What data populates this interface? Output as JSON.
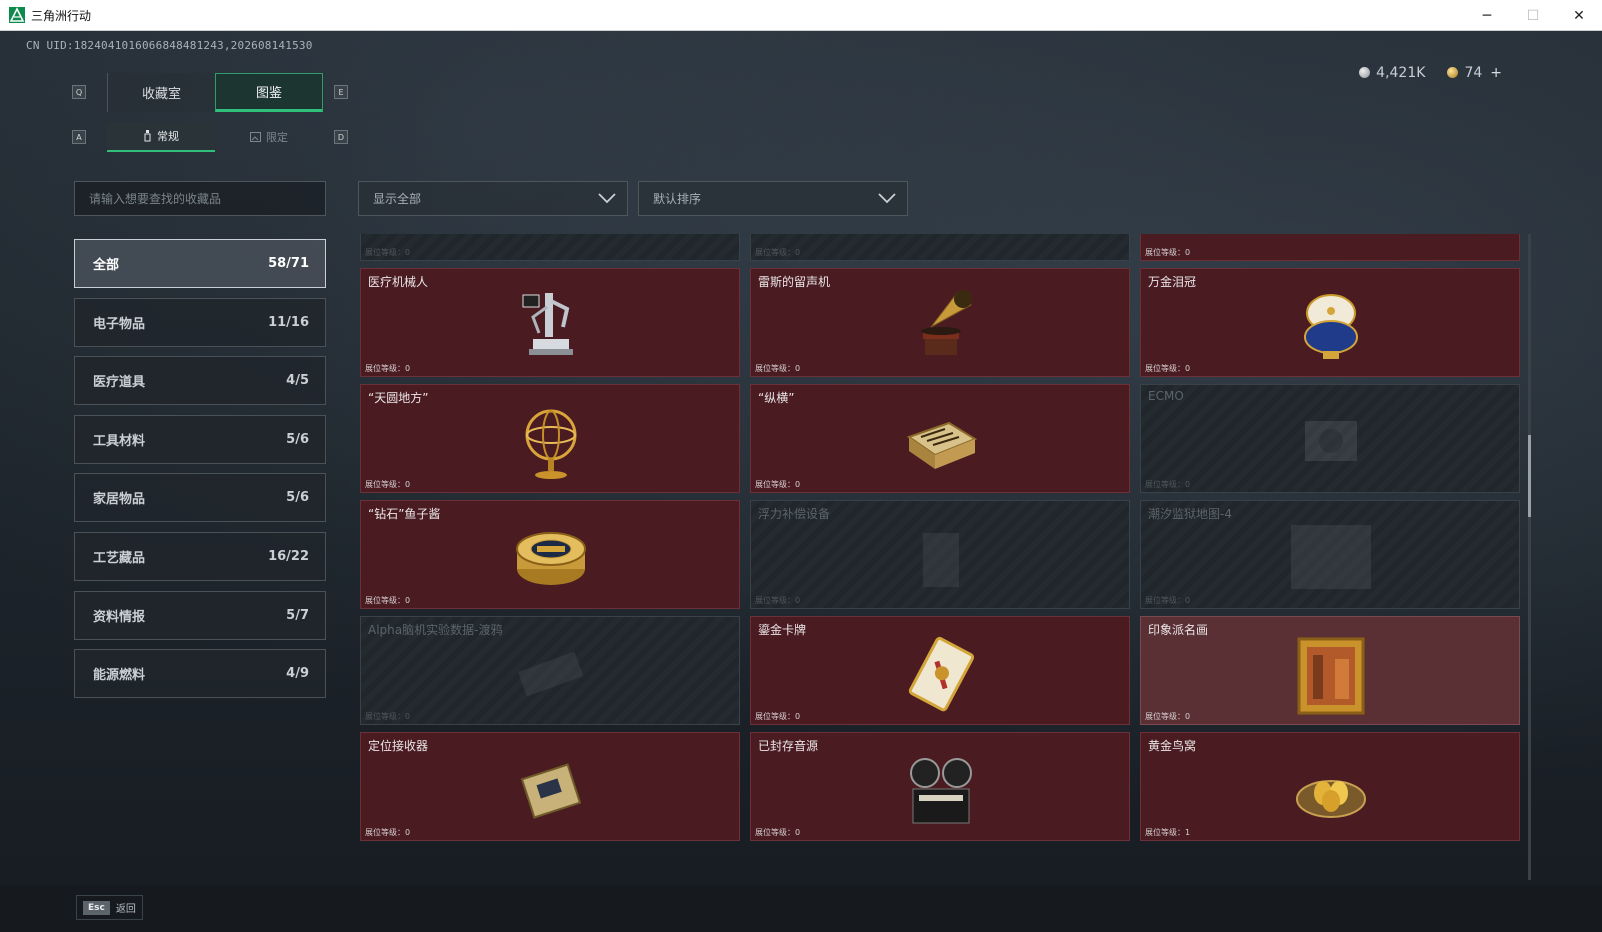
{
  "window": {
    "title": "三角洲行动",
    "minimize": "─",
    "maximize": "☐",
    "close": "✕"
  },
  "uid": "CN UID:1824041016066848481243,202608141530",
  "currency": {
    "silver": "4,421K",
    "gold": "74",
    "plus": "+"
  },
  "keys": {
    "q": "Q",
    "e": "E",
    "a": "A",
    "d": "D"
  },
  "tabs": [
    {
      "label": "收藏室"
    },
    {
      "label": "图鉴",
      "active": true
    }
  ],
  "subtabs": [
    {
      "label": "常规",
      "icon": "bottle-icon",
      "active": true
    },
    {
      "label": "限定",
      "icon": "picture-icon"
    }
  ],
  "search": {
    "placeholder": "请输入想要查找的收藏品"
  },
  "filters": {
    "show": "显示全部",
    "sort": "默认排序"
  },
  "categories": [
    {
      "label": "全部",
      "count": "58/71",
      "active": true
    },
    {
      "label": "电子物品",
      "count": "11/16"
    },
    {
      "label": "医疗道具",
      "count": "4/5"
    },
    {
      "label": "工具材料",
      "count": "5/6"
    },
    {
      "label": "家居物品",
      "count": "5/6"
    },
    {
      "label": "工艺藏品",
      "count": "16/22"
    },
    {
      "label": "资料情报",
      "count": "5/7"
    },
    {
      "label": "能源燃料",
      "count": "4/9"
    }
  ],
  "cards": [
    {
      "name": "",
      "level": "展位等级：0",
      "state": "locked",
      "icon": "partial-item-icon"
    },
    {
      "name": "",
      "level": "展位等级：0",
      "state": "locked",
      "icon": "partial-item-icon"
    },
    {
      "name": "",
      "level": "展位等级：0",
      "state": "owned",
      "icon": "partial-item-icon"
    },
    {
      "name": "医疗机械人",
      "level": "展位等级：0",
      "state": "owned",
      "icon": "medical-robot-icon"
    },
    {
      "name": "雷斯的留声机",
      "level": "展位等级：0",
      "state": "owned",
      "icon": "gramophone-icon"
    },
    {
      "name": "万金泪冠",
      "level": "展位等级：0",
      "state": "owned",
      "icon": "jeweled-egg-icon"
    },
    {
      "name": "“天圆地方”",
      "level": "展位等级：0",
      "state": "owned",
      "icon": "armillary-sphere-icon"
    },
    {
      "name": "“纵横”",
      "level": "展位等级：0",
      "state": "owned",
      "icon": "chess-box-icon"
    },
    {
      "name": "ECMO",
      "level": "展位等级：0",
      "state": "locked",
      "icon": "ecmo-icon"
    },
    {
      "name": "“钻石”鱼子酱",
      "level": "展位等级：0",
      "state": "owned",
      "icon": "caviar-tin-icon"
    },
    {
      "name": "浮力补偿设备",
      "level": "展位等级：0",
      "state": "locked",
      "icon": "buoyancy-device-icon"
    },
    {
      "name": "潮汐监狱地图-4",
      "level": "展位等级：0",
      "state": "locked",
      "icon": "map-icon"
    },
    {
      "name": "Alpha脑机实验数据-渡鸦",
      "level": "展位等级：0",
      "state": "locked",
      "icon": "data-drive-icon"
    },
    {
      "name": "鎏金卡牌",
      "level": "展位等级：0",
      "state": "owned",
      "icon": "gilded-card-icon"
    },
    {
      "name": "印象派名画",
      "level": "展位等级：0",
      "state": "owned_light",
      "icon": "painting-icon"
    },
    {
      "name": "定位接收器",
      "level": "展位等级：0",
      "state": "owned",
      "icon": "receiver-icon"
    },
    {
      "name": "已封存音源",
      "level": "展位等级：0",
      "state": "owned",
      "icon": "reel-recorder-icon"
    },
    {
      "name": "黄金鸟窝",
      "level": "展位等级：1",
      "state": "owned",
      "icon": "golden-nest-icon"
    }
  ],
  "footer": {
    "esc_key": "Esc",
    "esc_label": "返回"
  }
}
